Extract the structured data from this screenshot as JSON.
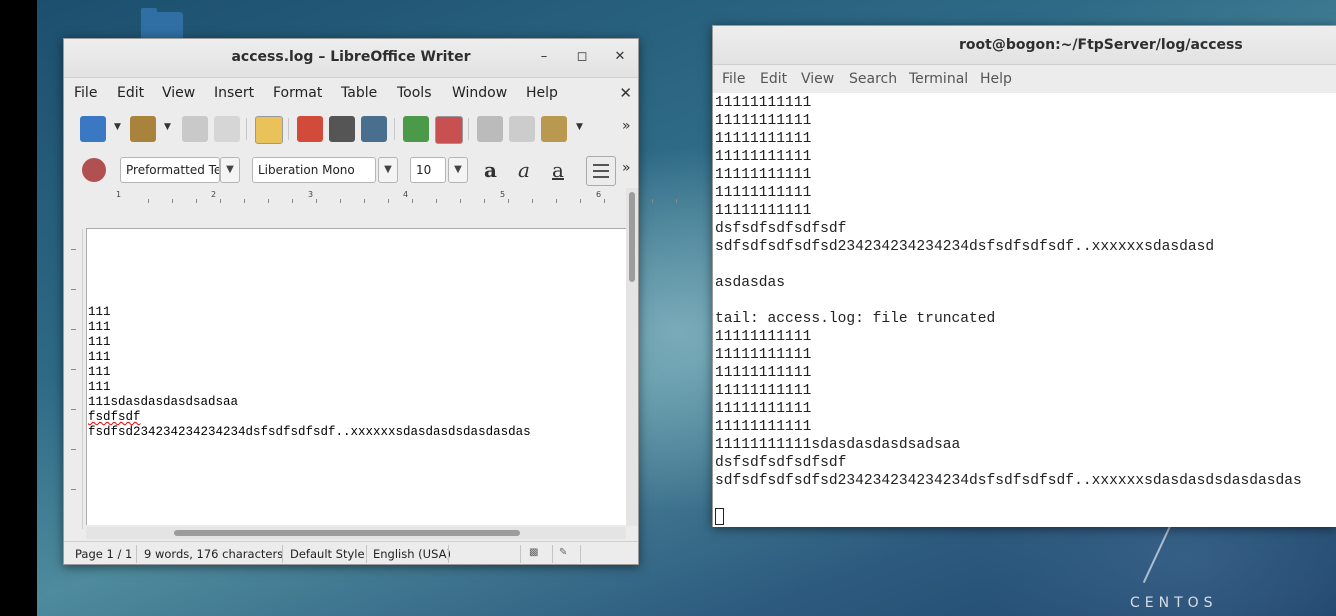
{
  "desktop": {
    "brand": "CENTOS"
  },
  "writer": {
    "title": "access.log – LibreOffice Writer",
    "menu": [
      "File",
      "Edit",
      "View",
      "Insert",
      "Format",
      "Table",
      "Tools",
      "Window",
      "Help"
    ],
    "paragraph_style": "Preformatted Te",
    "font_name": "Liberation Mono",
    "font_size": "10",
    "ruler_numbers": [
      "1",
      "2",
      "3",
      "4",
      "5",
      "6"
    ],
    "doc_lines": [
      "111",
      "111",
      "111",
      "111",
      "111",
      "111",
      "111sdasdasdasdsadsaa",
      "fsdfsdf",
      "fsdfsd234234234234234dsfsdfsdfsdf..xxxxxxsdasdasdsdasdasdas"
    ],
    "status": {
      "page": "Page 1 / 1",
      "words": "9 words, 176 characters",
      "style": "Default Style",
      "language": "English (USA)"
    }
  },
  "terminal": {
    "title": "root@bogon:~/FtpServer/log/access",
    "menu": [
      "File",
      "Edit",
      "View",
      "Search",
      "Terminal",
      "Help"
    ],
    "lines": [
      "11111111111",
      "11111111111",
      "11111111111",
      "11111111111",
      "11111111111",
      "11111111111",
      "11111111111",
      "dsfsdfsdfsdfsdf",
      "sdfsdfsdfsdfsd234234234234234dsfsdfsdfsdf..xxxxxxsdasdasd",
      "",
      "asdasdas",
      "",
      "tail: access.log: file truncated",
      "11111111111",
      "11111111111",
      "11111111111",
      "11111111111",
      "11111111111",
      "11111111111",
      "11111111111sdasdasdasdsadsaa",
      "dsfsdfsdfsdfsdf",
      "sdfsdfsdfsdfsd234234234234234dsfsdfsdfsdf..xxxxxxsdasdasdsdasdasdas"
    ]
  }
}
